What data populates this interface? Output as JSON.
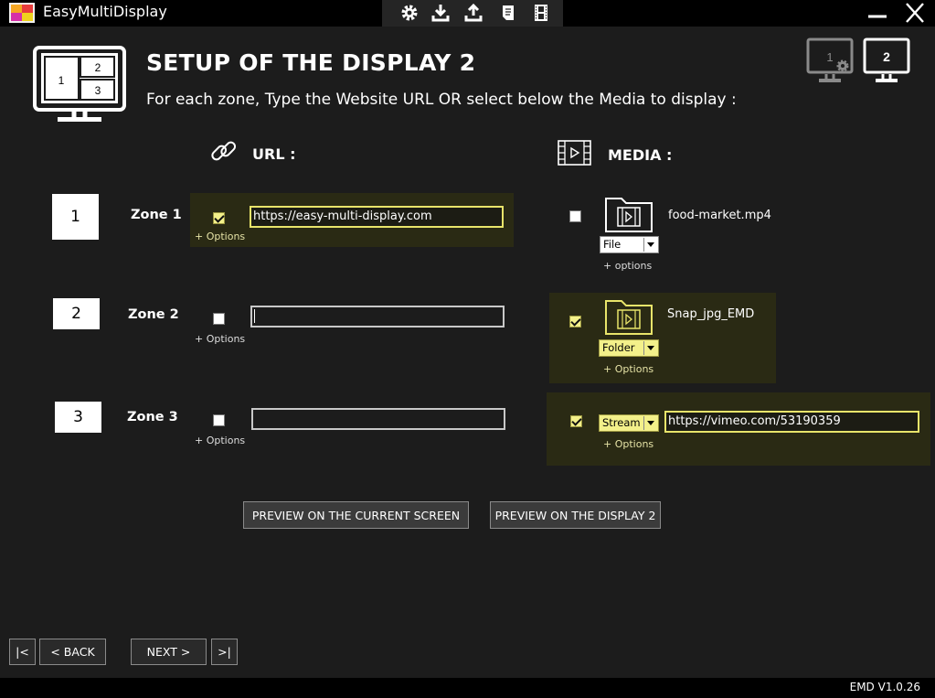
{
  "app": {
    "title": "EasyMultiDisplay",
    "version": "EMD V1.0.26"
  },
  "toolbar": {
    "icons": [
      "gear-icon",
      "download-icon",
      "upload-icon",
      "document-icon",
      "film-icon"
    ]
  },
  "header": {
    "title": "SETUP OF THE DISPLAY 2",
    "subtitle": "For each zone, Type the Website URL OR select below the Media to display :",
    "monitor_zone_labels": [
      "1",
      "2",
      "3"
    ],
    "display_buttons": [
      {
        "label": "1",
        "icon": "monitor-gear-icon",
        "active": false
      },
      {
        "label": "2",
        "icon": "monitor-icon",
        "active": true
      }
    ]
  },
  "sections": {
    "url_label": "URL :",
    "media_label": "MEDIA :"
  },
  "zones": [
    {
      "number": "1",
      "label": "Zone 1",
      "url": {
        "checked": true,
        "value": "https://easy-multi-display.com",
        "options": "+ Options"
      },
      "media": {
        "checked": false,
        "type": "File",
        "name": "food-market.mp4",
        "options": "+ options"
      }
    },
    {
      "number": "2",
      "label": "Zone 2",
      "url": {
        "checked": false,
        "value": "",
        "options": "+ Options"
      },
      "media": {
        "checked": true,
        "type": "Folder",
        "name": "Snap_jpg_EMD",
        "options": "+ Options"
      }
    },
    {
      "number": "3",
      "label": "Zone 3",
      "url": {
        "checked": false,
        "value": "",
        "options": "+ Options"
      },
      "media": {
        "checked": true,
        "type": "Stream",
        "name": "https://vimeo.com/53190359",
        "options": "+ Options"
      }
    }
  ],
  "actions": {
    "preview_current": "PREVIEW ON THE CURRENT SCREEN",
    "preview_display": "PREVIEW ON THE DISPLAY 2"
  },
  "nav": {
    "first": "|<",
    "back": "< BACK",
    "next": "NEXT >",
    "last": ">|"
  },
  "colors": {
    "highlight": "#f3f08a",
    "active_panel": "#2a2a14",
    "background": "#1c1c1c"
  }
}
